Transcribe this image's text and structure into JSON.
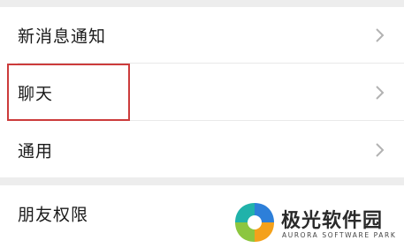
{
  "settings": {
    "items": [
      {
        "label": "新消息通知",
        "icon": "chevron-right-icon"
      },
      {
        "label": "聊天",
        "icon": "chevron-right-icon"
      },
      {
        "label": "通用",
        "icon": "chevron-right-icon"
      }
    ],
    "second_group": [
      {
        "label": "朋友权限"
      }
    ]
  },
  "annotation": {
    "color": "#cc3b3b"
  },
  "watermark": {
    "title": "极光软件园",
    "subtitle": "AURORA SOFTWARE PARK"
  },
  "colors": {
    "background": "#ededed",
    "row_background": "#ffffff",
    "text": "#1a1a1a",
    "chevron": "#b2b2b2"
  }
}
